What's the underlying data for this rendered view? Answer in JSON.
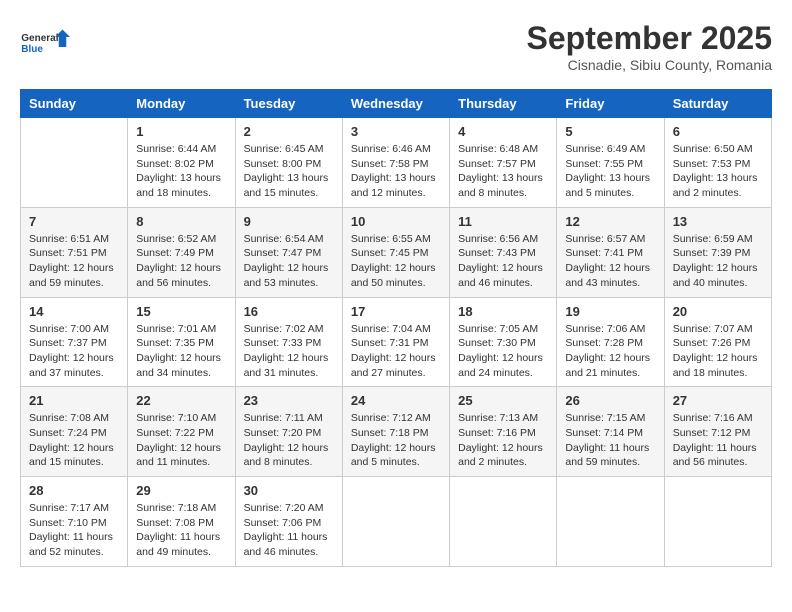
{
  "logo": {
    "line1": "General",
    "line2": "Blue"
  },
  "title": "September 2025",
  "subtitle": "Cisnadie, Sibiu County, Romania",
  "days_of_week": [
    "Sunday",
    "Monday",
    "Tuesday",
    "Wednesday",
    "Thursday",
    "Friday",
    "Saturday"
  ],
  "weeks": [
    [
      {
        "day": "",
        "sunrise": "",
        "sunset": "",
        "daylight": ""
      },
      {
        "day": "1",
        "sunrise": "Sunrise: 6:44 AM",
        "sunset": "Sunset: 8:02 PM",
        "daylight": "Daylight: 13 hours and 18 minutes."
      },
      {
        "day": "2",
        "sunrise": "Sunrise: 6:45 AM",
        "sunset": "Sunset: 8:00 PM",
        "daylight": "Daylight: 13 hours and 15 minutes."
      },
      {
        "day": "3",
        "sunrise": "Sunrise: 6:46 AM",
        "sunset": "Sunset: 7:58 PM",
        "daylight": "Daylight: 13 hours and 12 minutes."
      },
      {
        "day": "4",
        "sunrise": "Sunrise: 6:48 AM",
        "sunset": "Sunset: 7:57 PM",
        "daylight": "Daylight: 13 hours and 8 minutes."
      },
      {
        "day": "5",
        "sunrise": "Sunrise: 6:49 AM",
        "sunset": "Sunset: 7:55 PM",
        "daylight": "Daylight: 13 hours and 5 minutes."
      },
      {
        "day": "6",
        "sunrise": "Sunrise: 6:50 AM",
        "sunset": "Sunset: 7:53 PM",
        "daylight": "Daylight: 13 hours and 2 minutes."
      }
    ],
    [
      {
        "day": "7",
        "sunrise": "Sunrise: 6:51 AM",
        "sunset": "Sunset: 7:51 PM",
        "daylight": "Daylight: 12 hours and 59 minutes."
      },
      {
        "day": "8",
        "sunrise": "Sunrise: 6:52 AM",
        "sunset": "Sunset: 7:49 PM",
        "daylight": "Daylight: 12 hours and 56 minutes."
      },
      {
        "day": "9",
        "sunrise": "Sunrise: 6:54 AM",
        "sunset": "Sunset: 7:47 PM",
        "daylight": "Daylight: 12 hours and 53 minutes."
      },
      {
        "day": "10",
        "sunrise": "Sunrise: 6:55 AM",
        "sunset": "Sunset: 7:45 PM",
        "daylight": "Daylight: 12 hours and 50 minutes."
      },
      {
        "day": "11",
        "sunrise": "Sunrise: 6:56 AM",
        "sunset": "Sunset: 7:43 PM",
        "daylight": "Daylight: 12 hours and 46 minutes."
      },
      {
        "day": "12",
        "sunrise": "Sunrise: 6:57 AM",
        "sunset": "Sunset: 7:41 PM",
        "daylight": "Daylight: 12 hours and 43 minutes."
      },
      {
        "day": "13",
        "sunrise": "Sunrise: 6:59 AM",
        "sunset": "Sunset: 7:39 PM",
        "daylight": "Daylight: 12 hours and 40 minutes."
      }
    ],
    [
      {
        "day": "14",
        "sunrise": "Sunrise: 7:00 AM",
        "sunset": "Sunset: 7:37 PM",
        "daylight": "Daylight: 12 hours and 37 minutes."
      },
      {
        "day": "15",
        "sunrise": "Sunrise: 7:01 AM",
        "sunset": "Sunset: 7:35 PM",
        "daylight": "Daylight: 12 hours and 34 minutes."
      },
      {
        "day": "16",
        "sunrise": "Sunrise: 7:02 AM",
        "sunset": "Sunset: 7:33 PM",
        "daylight": "Daylight: 12 hours and 31 minutes."
      },
      {
        "day": "17",
        "sunrise": "Sunrise: 7:04 AM",
        "sunset": "Sunset: 7:31 PM",
        "daylight": "Daylight: 12 hours and 27 minutes."
      },
      {
        "day": "18",
        "sunrise": "Sunrise: 7:05 AM",
        "sunset": "Sunset: 7:30 PM",
        "daylight": "Daylight: 12 hours and 24 minutes."
      },
      {
        "day": "19",
        "sunrise": "Sunrise: 7:06 AM",
        "sunset": "Sunset: 7:28 PM",
        "daylight": "Daylight: 12 hours and 21 minutes."
      },
      {
        "day": "20",
        "sunrise": "Sunrise: 7:07 AM",
        "sunset": "Sunset: 7:26 PM",
        "daylight": "Daylight: 12 hours and 18 minutes."
      }
    ],
    [
      {
        "day": "21",
        "sunrise": "Sunrise: 7:08 AM",
        "sunset": "Sunset: 7:24 PM",
        "daylight": "Daylight: 12 hours and 15 minutes."
      },
      {
        "day": "22",
        "sunrise": "Sunrise: 7:10 AM",
        "sunset": "Sunset: 7:22 PM",
        "daylight": "Daylight: 12 hours and 11 minutes."
      },
      {
        "day": "23",
        "sunrise": "Sunrise: 7:11 AM",
        "sunset": "Sunset: 7:20 PM",
        "daylight": "Daylight: 12 hours and 8 minutes."
      },
      {
        "day": "24",
        "sunrise": "Sunrise: 7:12 AM",
        "sunset": "Sunset: 7:18 PM",
        "daylight": "Daylight: 12 hours and 5 minutes."
      },
      {
        "day": "25",
        "sunrise": "Sunrise: 7:13 AM",
        "sunset": "Sunset: 7:16 PM",
        "daylight": "Daylight: 12 hours and 2 minutes."
      },
      {
        "day": "26",
        "sunrise": "Sunrise: 7:15 AM",
        "sunset": "Sunset: 7:14 PM",
        "daylight": "Daylight: 11 hours and 59 minutes."
      },
      {
        "day": "27",
        "sunrise": "Sunrise: 7:16 AM",
        "sunset": "Sunset: 7:12 PM",
        "daylight": "Daylight: 11 hours and 56 minutes."
      }
    ],
    [
      {
        "day": "28",
        "sunrise": "Sunrise: 7:17 AM",
        "sunset": "Sunset: 7:10 PM",
        "daylight": "Daylight: 11 hours and 52 minutes."
      },
      {
        "day": "29",
        "sunrise": "Sunrise: 7:18 AM",
        "sunset": "Sunset: 7:08 PM",
        "daylight": "Daylight: 11 hours and 49 minutes."
      },
      {
        "day": "30",
        "sunrise": "Sunrise: 7:20 AM",
        "sunset": "Sunset: 7:06 PM",
        "daylight": "Daylight: 11 hours and 46 minutes."
      },
      {
        "day": "",
        "sunrise": "",
        "sunset": "",
        "daylight": ""
      },
      {
        "day": "",
        "sunrise": "",
        "sunset": "",
        "daylight": ""
      },
      {
        "day": "",
        "sunrise": "",
        "sunset": "",
        "daylight": ""
      },
      {
        "day": "",
        "sunrise": "",
        "sunset": "",
        "daylight": ""
      }
    ]
  ]
}
